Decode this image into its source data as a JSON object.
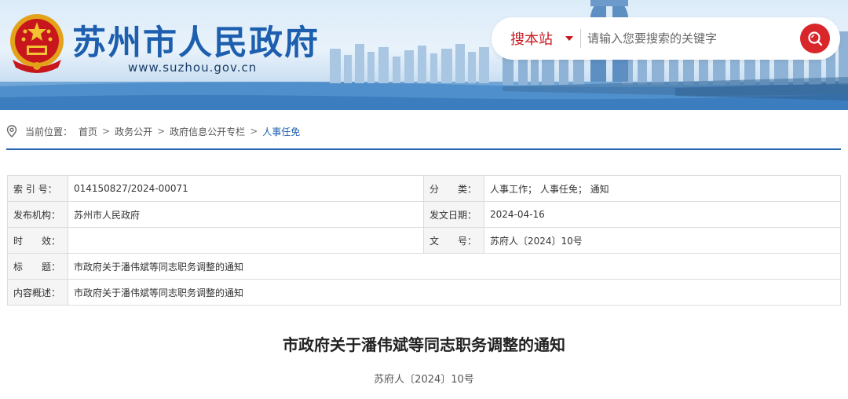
{
  "header": {
    "site_title": "苏州市人民政府",
    "site_url": "www.suzhou.gov.cn",
    "search": {
      "scope": "搜本站",
      "placeholder": "请输入您要搜索的关键字",
      "button_icon": "search-icon"
    }
  },
  "breadcrumb": {
    "label": "当前位置：",
    "items": [
      "首页",
      "政务公开",
      "政府信息公开专栏"
    ],
    "current": "人事任免",
    "separator": ">"
  },
  "meta": {
    "rows": [
      {
        "k1": "索 引 号：",
        "v1": "014150827/2024-00071",
        "k2": "分　　类：",
        "v2": "人事工作； 人事任免； 通知"
      },
      {
        "k1": "发布机构：",
        "v1": "苏州市人民政府",
        "k2": "发文日期：",
        "v2": "2024-04-16"
      },
      {
        "k1": "时　　效：",
        "v1": "",
        "k2": "文　　号：",
        "v2": "苏府人〔2024〕10号"
      },
      {
        "k1": "标　　题：",
        "v1": "市政府关于潘伟斌等同志职务调整的通知"
      },
      {
        "k1": "内容概述：",
        "v1": "市政府关于潘伟斌等同志职务调整的通知"
      }
    ]
  },
  "document": {
    "title": "市政府关于潘伟斌等同志职务调整的通知",
    "number": "苏府人〔2024〕10号"
  },
  "colors": {
    "brand_blue": "#1d5fae",
    "accent_red": "#c8161d",
    "rule_blue": "#2566ae"
  }
}
